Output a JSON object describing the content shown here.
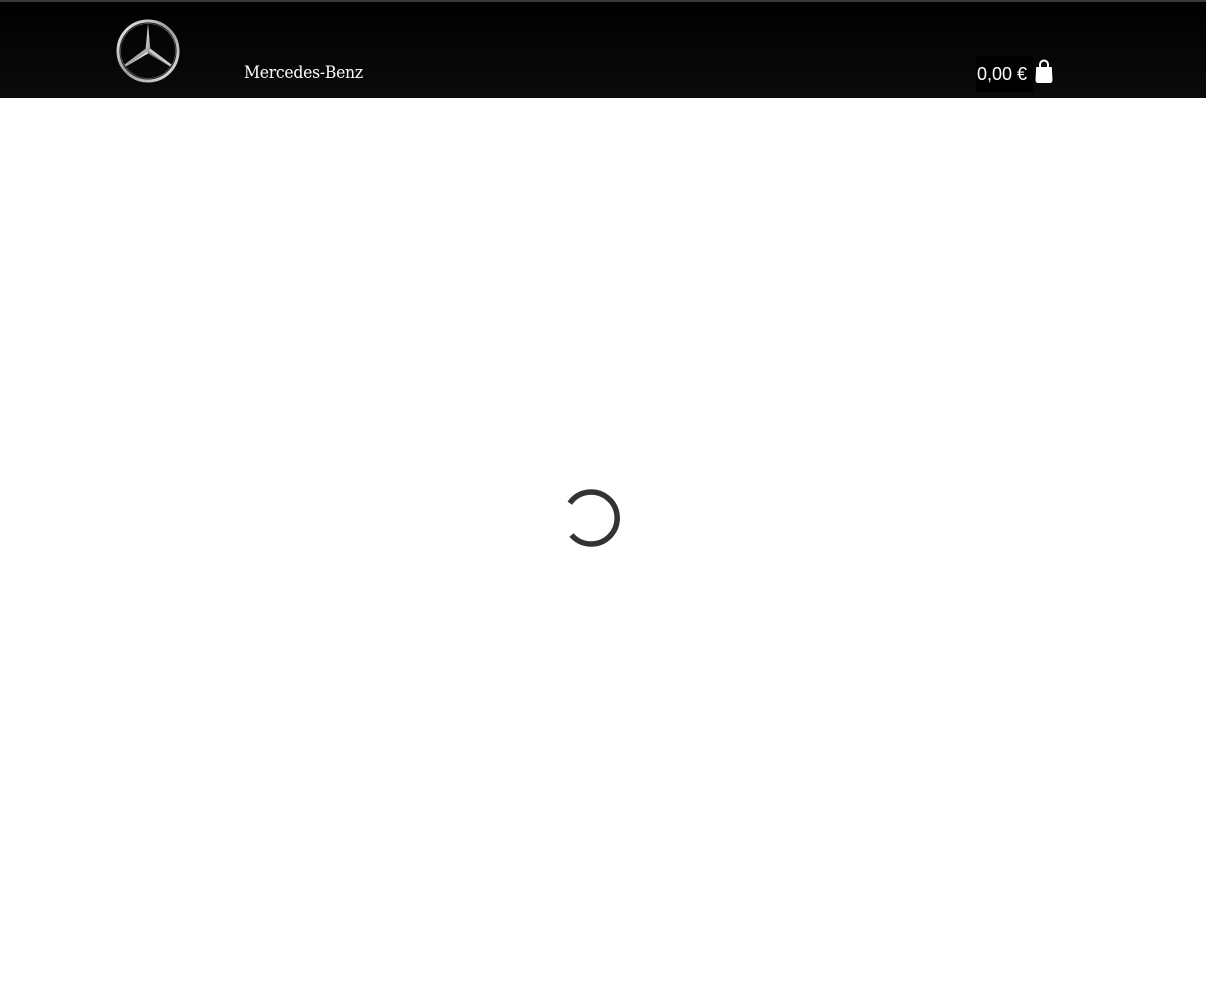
{
  "header": {
    "logo_icon": "mercedes-star-icon",
    "brand_name": "Mercedes-Benz",
    "cart": {
      "total": "0,00 €",
      "icon": "shopping-bag-icon"
    }
  },
  "main": {
    "loading_indicator": "spinner-icon"
  },
  "colors": {
    "header_background": "#000000",
    "header_text": "#ffffff",
    "page_background": "#ffffff",
    "spinner": "#333333"
  }
}
